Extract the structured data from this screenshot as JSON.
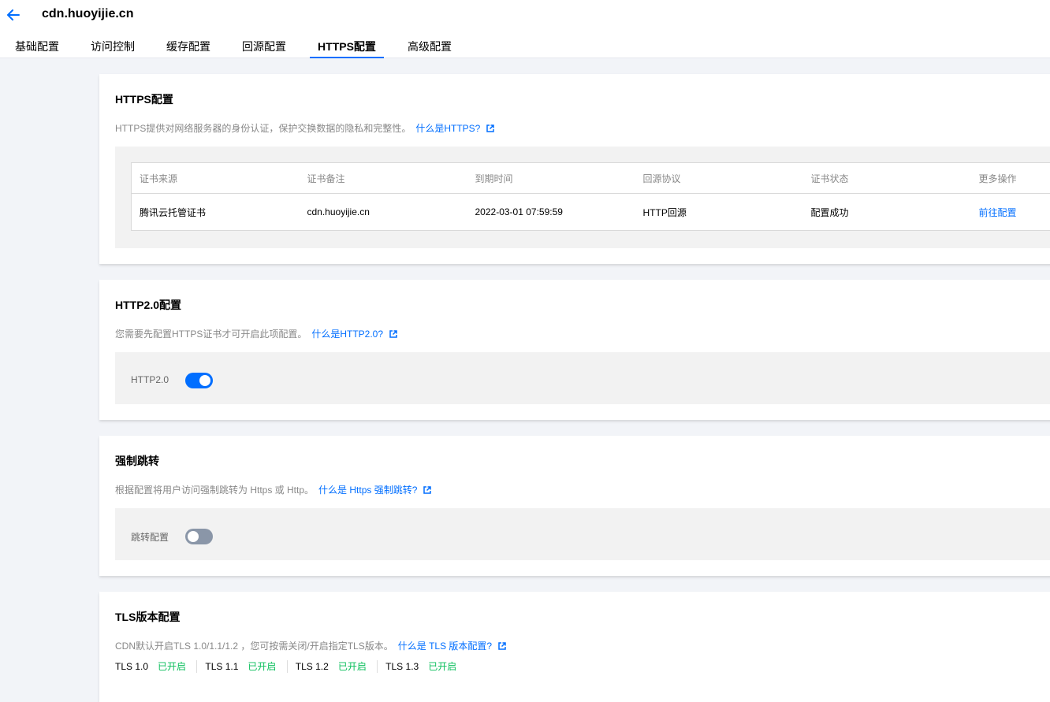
{
  "header": {
    "title": "cdn.huoyijie.cn",
    "tabs": [
      {
        "label": "基础配置",
        "active": false
      },
      {
        "label": "访问控制",
        "active": false
      },
      {
        "label": "缓存配置",
        "active": false
      },
      {
        "label": "回源配置",
        "active": false
      },
      {
        "label": "HTTPS配置",
        "active": true
      },
      {
        "label": "高级配置",
        "active": false
      }
    ]
  },
  "https": {
    "title": "HTTPS配置",
    "desc": "HTTPS提供对网络服务器的身份认证，保护交换数据的隐私和完整性。",
    "link": "什么是HTTPS?",
    "table": {
      "headers": [
        "证书来源",
        "证书备注",
        "到期时间",
        "回源协议",
        "证书状态",
        "更多操作"
      ],
      "rows": [
        [
          "腾讯云托管证书",
          "cdn.huoyijie.cn",
          "2022-03-01 07:59:59",
          "HTTP回源",
          "配置成功",
          "前往配置"
        ]
      ]
    }
  },
  "http2": {
    "title": "HTTP2.0配置",
    "desc": "您需要先配置HTTPS证书才可开启此项配置。",
    "link": "什么是HTTP2.0?",
    "toggle_label": "HTTP2.0",
    "enabled": true
  },
  "redirect": {
    "title": "强制跳转",
    "desc": "根据配置将用户访问强制跳转为 Https 或 Http。",
    "link": "什么是 Https 强制跳转?",
    "toggle_label": "跳转配置",
    "enabled": false
  },
  "tls": {
    "title": "TLS版本配置",
    "desc": "CDN默认开启TLS 1.0/1.1/1.2 ，您可按需关闭/开启指定TLS版本。",
    "link": "什么是 TLS 版本配置?",
    "versions": [
      {
        "version": "TLS 1.0",
        "status": "已开启"
      },
      {
        "version": "TLS 1.1",
        "status": "已开启"
      },
      {
        "version": "TLS 1.2",
        "status": "已开启"
      },
      {
        "version": "TLS 1.3",
        "status": "已开启"
      }
    ]
  },
  "colors": {
    "accent": "#006eff",
    "success": "#0abf5b",
    "muted": "#888888"
  }
}
